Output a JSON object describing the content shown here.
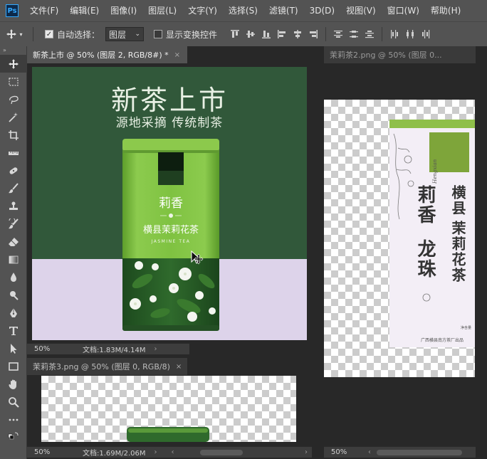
{
  "app": {
    "logo": "Ps"
  },
  "menu": [
    "文件(F)",
    "编辑(E)",
    "图像(I)",
    "图层(L)",
    "文字(Y)",
    "选择(S)",
    "滤镜(T)",
    "3D(D)",
    "视图(V)",
    "窗口(W)",
    "帮助(H)"
  ],
  "options": {
    "auto_select_label": "自动选择：",
    "auto_select_checked": true,
    "layer_select_value": "图层",
    "show_transform_label": "显示变换控件",
    "show_transform_checked": false
  },
  "toolbar": {
    "collapse": "»"
  },
  "doc1": {
    "tab_title": "新茶上市 @ 50% (图层 2, RGB/8#) *",
    "close": "×",
    "zoom": "50%",
    "docsize": "文档:1.83M/4.14M",
    "canvas": {
      "headline": "新茶上市",
      "subheadline": "源地采摘 传统制茶",
      "tin_name": "莉香",
      "tin_product": "横县茉莉花茶",
      "tin_english": "JASMINE TEA",
      "colors": {
        "top_bg": "#31583a",
        "bottom_bg": "#ddd3ea",
        "tin_green": "#7fc241"
      }
    }
  },
  "doc2": {
    "tab_title": "茉莉茶2.png @ 50% (图层 0...",
    "zoom": "50%",
    "canvas": {
      "brand_vertical_1": "莉香",
      "brand_vertical_2": "龙珠",
      "product_vertical_1": "横县",
      "product_vertical_2": "茉莉花茶",
      "side_english": "Hengxian",
      "net_weight": "净含量",
      "maker": "广西横县南方茶厂出品"
    }
  },
  "doc3": {
    "tab_title": "茉莉茶3.png @ 50% (图层 0, RGB/8)",
    "close": "×",
    "zoom": "50%",
    "docsize": "文档:1.69M/2.06M"
  }
}
